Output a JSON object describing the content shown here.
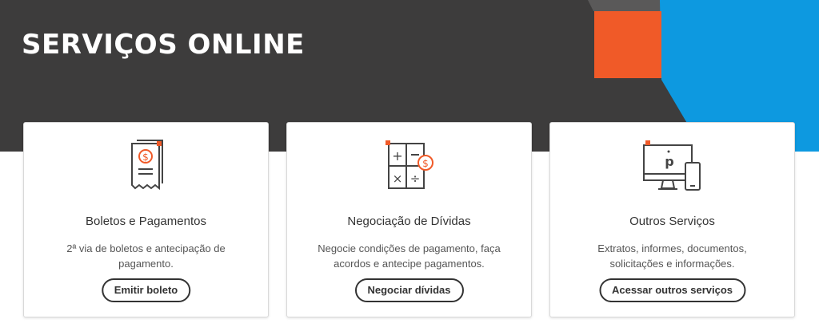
{
  "hero": {
    "title": "SERVIÇOS ONLINE",
    "colors": {
      "background": "#3d3c3c",
      "orange": "#f05a28",
      "blue": "#0d99e0"
    }
  },
  "cards": [
    {
      "icon": "receipt-dollar-icon",
      "title": "Boletos e Pagamentos",
      "description": "2ª via de boletos e antecipação de pagamento.",
      "button_label": "Emitir boleto"
    },
    {
      "icon": "calculator-dollar-icon",
      "title": "Negociação de Dívidas",
      "description": "Negocie condições de pagamento, faça acordos e antecipe pagamentos.",
      "button_label": "Negociar dívidas"
    },
    {
      "icon": "monitor-phone-icon",
      "title": "Outros Serviços",
      "description": "Extratos, informes, documentos, solicitações e informações.",
      "button_label": "Acessar outros serviços"
    }
  ]
}
